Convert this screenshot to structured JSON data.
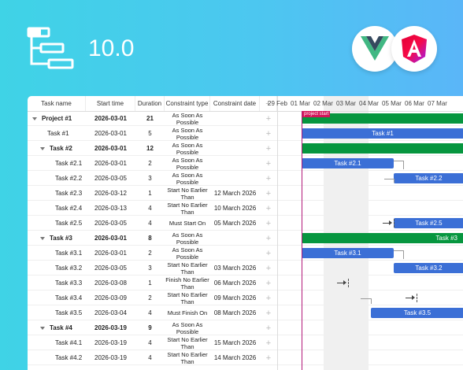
{
  "version": "10.0",
  "colors": {
    "accent_blue": "#3b6fd6",
    "accent_green": "#06963f",
    "marker": "#d4145a"
  },
  "grid": {
    "columns": [
      "Task name",
      "Start time",
      "Duration",
      "Constraint type",
      "Constraint date",
      "+"
    ],
    "rows": [
      {
        "name": "Project #1",
        "start": "2026-03-01",
        "duration": "21",
        "ctype": "As Soon As Possible",
        "cdate": "",
        "level": 0,
        "group": true
      },
      {
        "name": "Task #1",
        "start": "2026-03-01",
        "duration": "5",
        "ctype": "As Soon As Possible",
        "cdate": "",
        "level": 1,
        "group": false
      },
      {
        "name": "Task #2",
        "start": "2026-03-01",
        "duration": "12",
        "ctype": "As Soon As Possible",
        "cdate": "",
        "level": 1,
        "group": true
      },
      {
        "name": "Task #2.1",
        "start": "2026-03-01",
        "duration": "2",
        "ctype": "As Soon As Possible",
        "cdate": "",
        "level": 2,
        "group": false
      },
      {
        "name": "Task #2.2",
        "start": "2026-03-05",
        "duration": "3",
        "ctype": "As Soon As Possible",
        "cdate": "",
        "level": 2,
        "group": false
      },
      {
        "name": "Task #2.3",
        "start": "2026-03-12",
        "duration": "1",
        "ctype": "Start No Earlier Than",
        "cdate": "12 March 2026",
        "level": 2,
        "group": false
      },
      {
        "name": "Task #2.4",
        "start": "2026-03-13",
        "duration": "4",
        "ctype": "Start No Earlier Than",
        "cdate": "10 March 2026",
        "level": 2,
        "group": false
      },
      {
        "name": "Task #2.5",
        "start": "2026-03-05",
        "duration": "4",
        "ctype": "Must Start On",
        "cdate": "05 March 2026",
        "level": 2,
        "group": false
      },
      {
        "name": "Task #3",
        "start": "2026-03-01",
        "duration": "8",
        "ctype": "As Soon As Possible",
        "cdate": "",
        "level": 1,
        "group": true
      },
      {
        "name": "Task #3.1",
        "start": "2026-03-01",
        "duration": "2",
        "ctype": "As Soon As Possible",
        "cdate": "",
        "level": 2,
        "group": false
      },
      {
        "name": "Task #3.2",
        "start": "2026-03-05",
        "duration": "3",
        "ctype": "Start No Earlier Than",
        "cdate": "03 March 2026",
        "level": 2,
        "group": false
      },
      {
        "name": "Task #3.3",
        "start": "2026-03-08",
        "duration": "1",
        "ctype": "Finish No Earlier Than",
        "cdate": "06 March 2026",
        "level": 2,
        "group": false
      },
      {
        "name": "Task #3.4",
        "start": "2026-03-09",
        "duration": "2",
        "ctype": "Start No Earlier Than",
        "cdate": "09 March 2026",
        "level": 2,
        "group": false
      },
      {
        "name": "Task #3.5",
        "start": "2026-03-04",
        "duration": "4",
        "ctype": "Must Finish On",
        "cdate": "08 March 2026",
        "level": 2,
        "group": false
      },
      {
        "name": "Task #4",
        "start": "2026-03-19",
        "duration": "9",
        "ctype": "As Soon As Possible",
        "cdate": "",
        "level": 1,
        "group": true
      },
      {
        "name": "Task #4.1",
        "start": "2026-03-19",
        "duration": "4",
        "ctype": "Start No Earlier Than",
        "cdate": "15 March 2026",
        "level": 2,
        "group": false
      },
      {
        "name": "Task #4.2",
        "start": "2026-03-19",
        "duration": "4",
        "ctype": "Start No Earlier Than",
        "cdate": "14 March 2026",
        "level": 2,
        "group": false
      }
    ]
  },
  "timeline": {
    "scale": [
      "29 Feb",
      "01 Mar",
      "02 Mar",
      "03 Mar",
      "04 Mar",
      "05 Mar",
      "06 Mar",
      "07 Mar"
    ],
    "marker_label": "project start",
    "bar_labels": [
      "Task #1",
      "Task #2.1",
      "Task #2.2",
      "Task #2.5",
      "Task #3",
      "Task #3.1",
      "Task #3.2",
      "Task #3.5"
    ]
  }
}
